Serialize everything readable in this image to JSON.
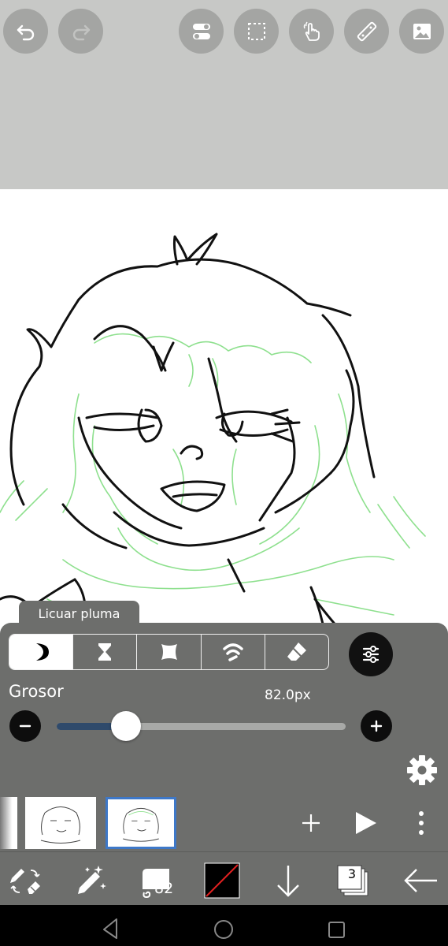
{
  "topbar": {
    "undo_icon": "undo-arrow-icon",
    "redo_icon": "redo-arrow-icon",
    "layer_toggle_icon": "toggle-switches-icon",
    "selection_icon": "dashed-selection-icon",
    "hand_icon": "hand-touch-icon",
    "ruler_icon": "ruler-icon",
    "image_icon": "image-icon"
  },
  "brush_panel": {
    "brush_name": "Licuar pluma",
    "thickness_label": "Grosor",
    "thickness_value": "82.0px",
    "thickness_fraction": 0.24,
    "segments": [
      "moon-brush-icon",
      "hourglass-icon",
      "diamond-shape-icon",
      "signal-wave-icon",
      "eraser-icon"
    ],
    "active_segment": 0
  },
  "layers_strip": {
    "add_icon": "+",
    "play_icon": "play-icon",
    "more_icon": "more-vertical-icon"
  },
  "bottom_toolbar": {
    "brush_size_number": "82",
    "layers_count": "3"
  },
  "colors": {
    "toolbar_bg": "#c7c8c6",
    "panel_bg": "#6d6e6c",
    "slider_fill": "#2f4a6b",
    "selected_layer_border": "#3e78c8",
    "sketch_green": "#8ee08e"
  }
}
